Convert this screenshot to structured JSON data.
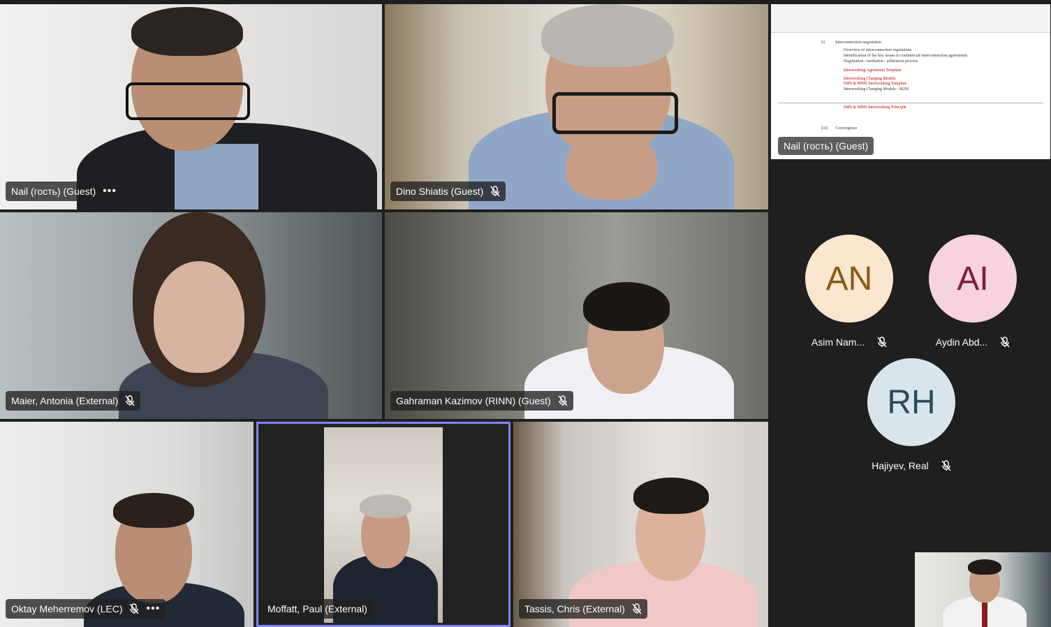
{
  "participants": {
    "nail": {
      "name": "Nail (гость) (Guest)"
    },
    "dino": {
      "name": "Dino Shiatis (Guest)"
    },
    "maier": {
      "name": "Maier, Antonia (External)"
    },
    "gahraman": {
      "name": "Gahraman Kazimov (RINN) (Guest)"
    },
    "oktay": {
      "name": "Oktay Meherremov (LEC)"
    },
    "moffatt": {
      "name": "Moffatt, Paul (External)"
    },
    "tassis": {
      "name": "Tassis, Chris (External)"
    }
  },
  "shared_screen": {
    "presenter": "Nail (гость) (Guest)",
    "lines": [
      "Interconnection negotiation",
      "Overview of interconnection regulations",
      "Identification of the key issues in commercial interconnection agreements",
      "Negotiation / mediation / arbitration process",
      "Interworking Agreement Template",
      "Interworking Charging Models",
      "SMS & MMS Interworking Template",
      "Interworking Charging Models - M2M",
      "SMS & MMS Interworking Principle",
      "Convergence"
    ],
    "markers": [
      "[i]",
      "[ii]",
      "[iii]"
    ]
  },
  "audio_only": [
    {
      "initials": "AN",
      "name": "Asim Nam...",
      "bg": "#fbe6d0",
      "fg": "#8a5a12"
    },
    {
      "initials": "AI",
      "name": "Aydin Abd...",
      "bg": "#f6d3de",
      "fg": "#7a1f3d"
    },
    {
      "initials": "RH",
      "name": "Hajiyev, Real",
      "bg": "#d8e6ec",
      "fg": "#2d4a58"
    }
  ],
  "colors": {
    "selected_outline": "#7f85f5",
    "stage_bg": "#1f1f1f"
  },
  "icons": [
    "mic-off-icon",
    "more-options-icon"
  ]
}
